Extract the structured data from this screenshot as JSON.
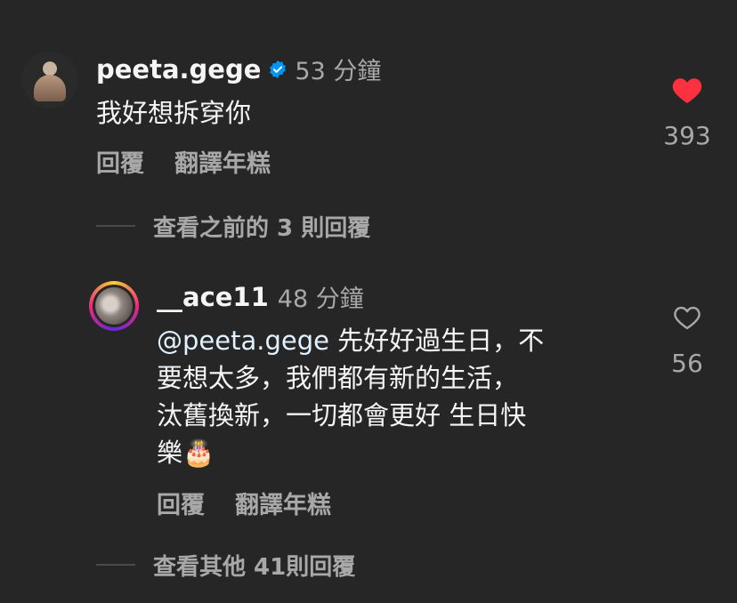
{
  "comment1": {
    "username": "peeta.gege",
    "time": "53 分鐘",
    "text": "我好想拆穿你",
    "reply_label": "回覆",
    "translate_label": "翻譯年糕",
    "likes": "393",
    "liked": true,
    "heart_color": "#ff3040",
    "verified_color": "#0095f6"
  },
  "view_previous": "查看之前的 3 則回覆",
  "comment2": {
    "username": "__ace11",
    "time": "48 分鐘",
    "mention": "@peeta.gege",
    "text_line1": "先好好過生日，不",
    "text_line2": "要想太多，我們都有新的生活，",
    "text_line3": "汰舊換新，一切都會更好 生日快",
    "text_line4": "樂",
    "emoji": "🎂",
    "reply_label": "回覆",
    "translate_label": "翻譯年糕",
    "likes": "56",
    "liked": false
  },
  "view_more": "查看其他 41則回覆"
}
